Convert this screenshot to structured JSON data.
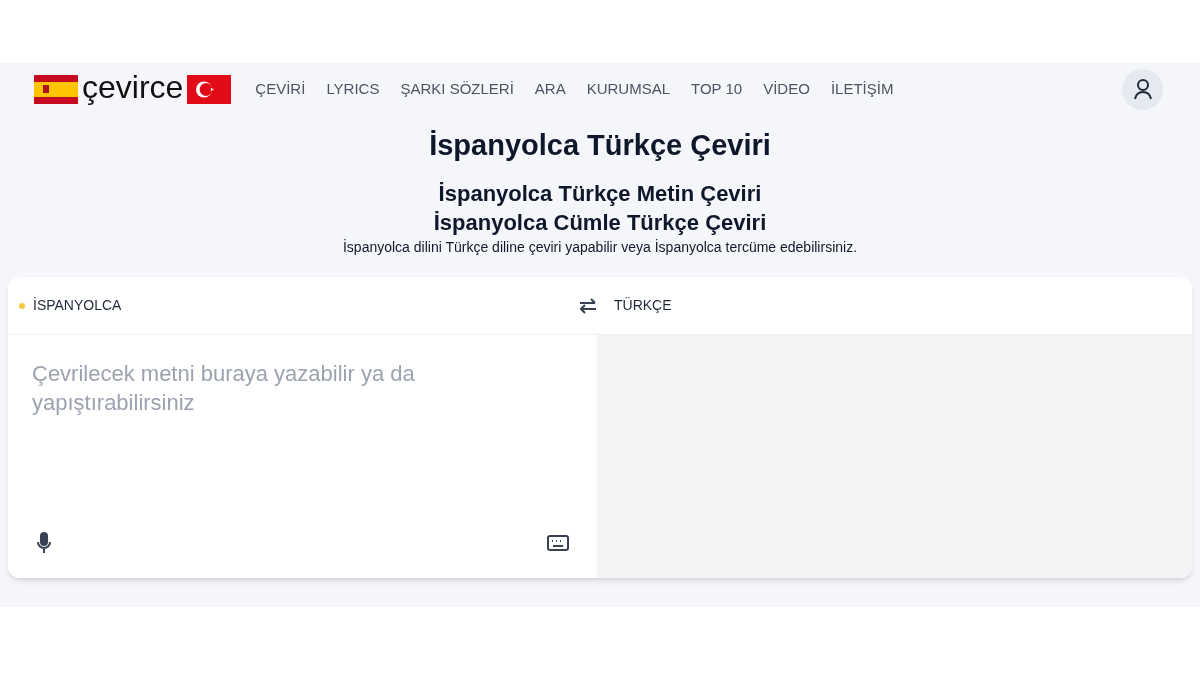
{
  "logo": {
    "text": "çevirce"
  },
  "nav": [
    {
      "label": "ÇEVİRİ"
    },
    {
      "label": "LYRICS"
    },
    {
      "label": "ŞARKI SÖZLERİ"
    },
    {
      "label": "ARA"
    },
    {
      "label": "KURUMSAL"
    },
    {
      "label": "TOP 10"
    },
    {
      "label": "VİDEO"
    },
    {
      "label": "İLETİŞİM"
    }
  ],
  "title": "İspanyolca Türkçe Çeviri",
  "subtitles": [
    "İspanyolca Türkçe Metin Çeviri",
    "İspanyolca Cümle Türkçe Çeviri"
  ],
  "description": "İspanyolca dilini Türkçe diline çeviri yapabilir veya İspanyolca tercüme edebilirsiniz.",
  "translator": {
    "source_language": "İSPANYOLCA",
    "target_language": "TÜRKÇE",
    "input": {
      "placeholder": "Çevrilecek metni buraya yazabilir ya da yapıştırabilirsiniz"
    }
  }
}
